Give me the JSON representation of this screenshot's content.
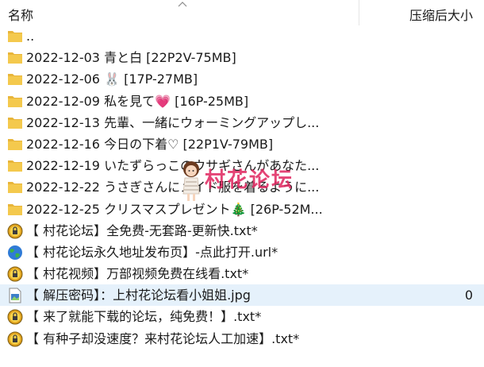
{
  "header": {
    "name_label": "名称",
    "size_label": "压缩后大小"
  },
  "colors": {
    "folder": "#f0c348",
    "selected_row": "#e5f1fb",
    "watermark": "#e0245e"
  },
  "files": [
    {
      "name": "..",
      "icon": "folder-icon",
      "size": ""
    },
    {
      "name": "2022-12-03 青と白 [22P2V-75MB]",
      "icon": "folder-icon",
      "size": ""
    },
    {
      "name": "2022-12-06 🐰 [17P-27MB]",
      "icon": "folder-icon",
      "size": ""
    },
    {
      "name": "2022-12-09 私を見て💗 [16P-25MB]",
      "icon": "folder-icon",
      "size": ""
    },
    {
      "name": "2022-12-13 先輩、一緒にウォーミングアップし...",
      "icon": "folder-icon",
      "size": ""
    },
    {
      "name": "2022-12-16 今日の下着♡ [22P1V-79MB]",
      "icon": "folder-icon",
      "size": ""
    },
    {
      "name": "2022-12-19 いたずらっこのウサギさんがあなた...",
      "icon": "folder-icon",
      "size": ""
    },
    {
      "name": "2022-12-22 うさぎさんにメイド服を着るように...",
      "icon": "folder-icon",
      "size": ""
    },
    {
      "name": "2022-12-25 クリスマスプレゼント🎄 [26P-52M...",
      "icon": "folder-icon",
      "size": ""
    },
    {
      "name": "【 村花论坛】全免费-无套路-更新快.txt*",
      "icon": "encrypted-text-file-icon",
      "size": ""
    },
    {
      "name": "【 村花论坛永久地址发布页】-点此打开.url*",
      "icon": "globe-url-icon",
      "size": ""
    },
    {
      "name": "【 村花视频】万部视频免费在线看.txt*",
      "icon": "encrypted-text-file-icon",
      "size": ""
    },
    {
      "name": "【 解压密码】：上村花论坛看小姐姐.jpg",
      "icon": "image-file-icon",
      "size": "0",
      "selected": true
    },
    {
      "name": "【 来了就能下载的论坛，纯免费！】.txt*",
      "icon": "encrypted-text-file-icon",
      "size": ""
    },
    {
      "name": "【 有种子却没速度？来村花论坛人工加速】.txt*",
      "icon": "encrypted-text-file-icon",
      "size": ""
    }
  ],
  "watermark": {
    "text": "村花论坛"
  }
}
